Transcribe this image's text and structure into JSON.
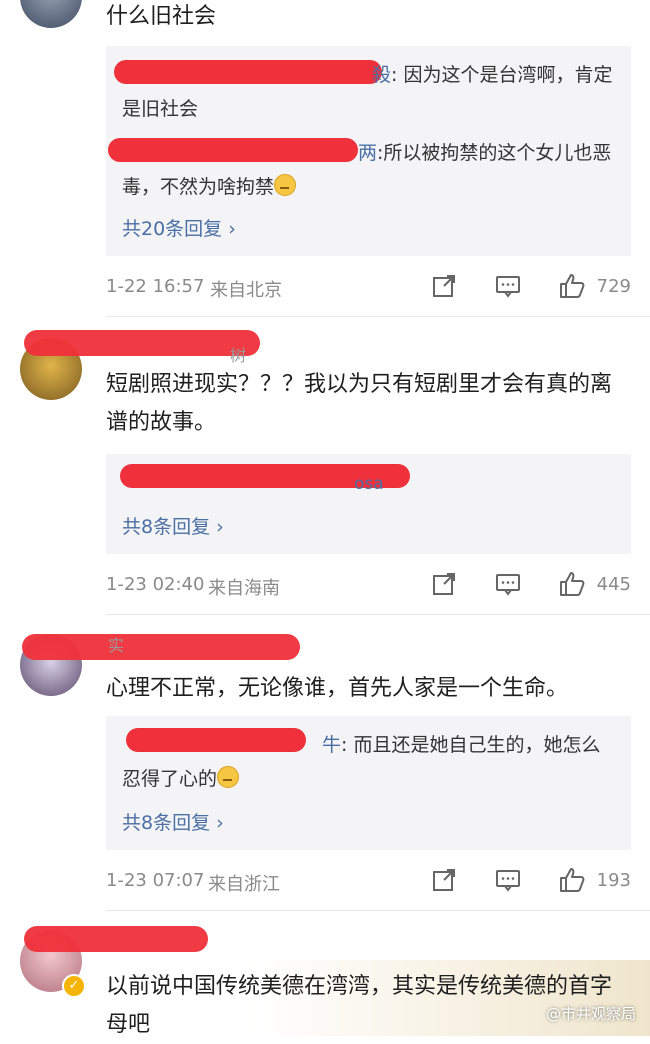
{
  "comments": [
    {
      "text": "什么旧社会",
      "replies": [
        {
          "name_suffix": "殺",
          "text": ": 因为这个是台湾啊，肯定是旧社会"
        },
        {
          "name_suffix": "两",
          "text": ":所以被拘禁的这个女儿也恶毒，不然为啥拘禁"
        }
      ],
      "more_replies": "共20条回复 ›",
      "time": "1-22 16:57",
      "location": "来自北京",
      "likes": "729"
    },
    {
      "username_fragment": "树",
      "text": "短剧照进现实？？？我以为只有短剧里才会有真的离谱的故事。",
      "reply_fragment": "osa",
      "more_replies": "共8条回复 ›",
      "time": "1-23 02:40",
      "location": "来自海南",
      "likes": "445"
    },
    {
      "username_fragment": "实",
      "text": "心理不正常，无论像谁，首先人家是一个生命。",
      "replies": [
        {
          "name_suffix": "牛",
          "text": ": 而且还是她自己生的，她怎么忍得了心的"
        }
      ],
      "more_replies": "共8条回复 ›",
      "time": "1-23 07:07",
      "location": "来自浙江",
      "likes": "193"
    },
    {
      "text": "以前说中国传统美德在湾湾，其实是传统美德的首字母吧"
    }
  ],
  "watermark": "@市井观察局",
  "icons": {
    "share": "share-icon",
    "comment": "comment-icon",
    "like": "thumbs-up-icon"
  },
  "colors": {
    "redaction": "#f0303a",
    "link": "#4a6fa5",
    "meta": "#8a8a8a",
    "reply_bg": "#f4f4f6"
  }
}
